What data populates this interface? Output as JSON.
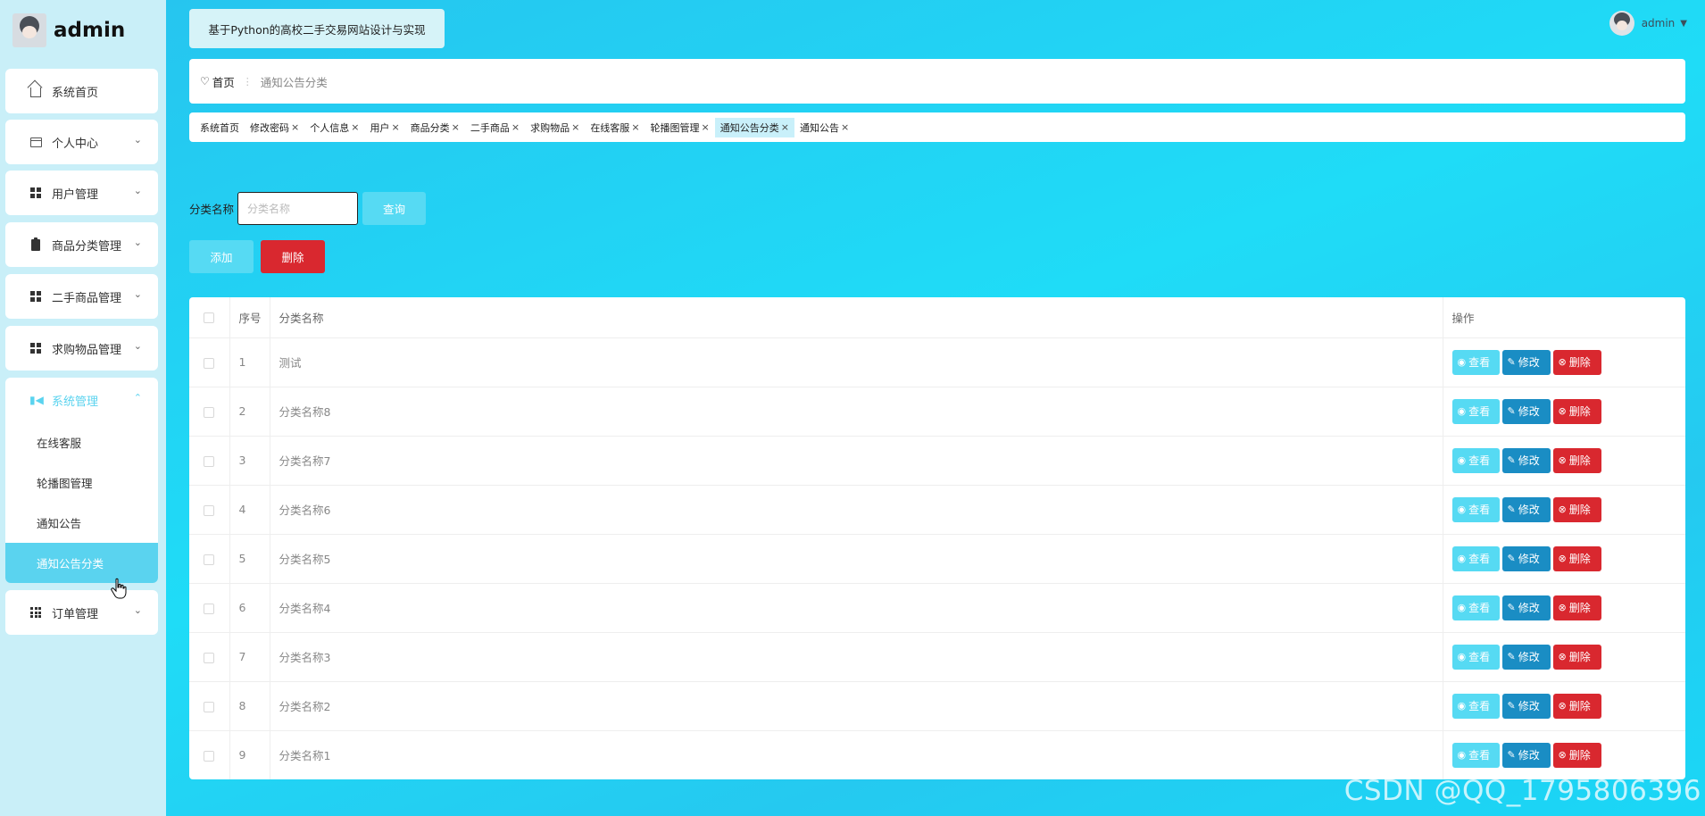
{
  "brand": {
    "name": "admin"
  },
  "sidebar": {
    "items": [
      {
        "label": "系统首页",
        "icon": "home-icon"
      },
      {
        "label": "个人中心",
        "icon": "id-card-icon"
      },
      {
        "label": "用户管理",
        "icon": "grid-icon"
      },
      {
        "label": "商品分类管理",
        "icon": "clipboard-icon"
      },
      {
        "label": "二手商品管理",
        "icon": "grid-icon"
      },
      {
        "label": "求购物品管理",
        "icon": "grid-icon"
      }
    ],
    "system": {
      "label": "系统管理",
      "icon": "video-icon",
      "subitems": [
        "在线客服",
        "轮播图管理",
        "通知公告",
        "通知公告分类"
      ],
      "active": "通知公告分类"
    },
    "orders": {
      "label": "订单管理",
      "icon": "grid9-icon"
    }
  },
  "header": {
    "site_title": "基于Python的高校二手交易网站设计与实现",
    "user": "admin"
  },
  "breadcrumb": {
    "home": "首页",
    "current": "通知公告分类"
  },
  "tabs": [
    {
      "label": "系统首页",
      "closable": false
    },
    {
      "label": "修改密码",
      "closable": true
    },
    {
      "label": "个人信息",
      "closable": true
    },
    {
      "label": "用户",
      "closable": true
    },
    {
      "label": "商品分类",
      "closable": true
    },
    {
      "label": "二手商品",
      "closable": true
    },
    {
      "label": "求购物品",
      "closable": true
    },
    {
      "label": "在线客服",
      "closable": true
    },
    {
      "label": "轮播图管理",
      "closable": true
    },
    {
      "label": "通知公告分类",
      "closable": true,
      "active": true
    },
    {
      "label": "通知公告",
      "closable": true
    }
  ],
  "tab_close_glyph": "×",
  "search": {
    "label": "分类名称",
    "placeholder": "分类名称",
    "value": "",
    "button": "查询"
  },
  "actions": {
    "add": "添加",
    "delete": "删除"
  },
  "table": {
    "headers": {
      "index": "序号",
      "name": "分类名称",
      "ops": "操作"
    },
    "row_actions": {
      "view": "查看",
      "edit": "修改",
      "delete": "删除"
    },
    "rows": [
      {
        "index": "1",
        "name": "测试"
      },
      {
        "index": "2",
        "name": "分类名称8"
      },
      {
        "index": "3",
        "name": "分类名称7"
      },
      {
        "index": "4",
        "name": "分类名称6"
      },
      {
        "index": "5",
        "name": "分类名称5"
      },
      {
        "index": "6",
        "name": "分类名称4"
      },
      {
        "index": "7",
        "name": "分类名称3"
      },
      {
        "index": "8",
        "name": "分类名称2"
      },
      {
        "index": "9",
        "name": "分类名称1"
      }
    ]
  },
  "watermark": "CSDN @QQ_1795806396",
  "colors": {
    "accent": "#56daf3",
    "danger": "#d9282f",
    "edit": "#1a8dc4",
    "sidebar_bg": "#c9eff8"
  }
}
